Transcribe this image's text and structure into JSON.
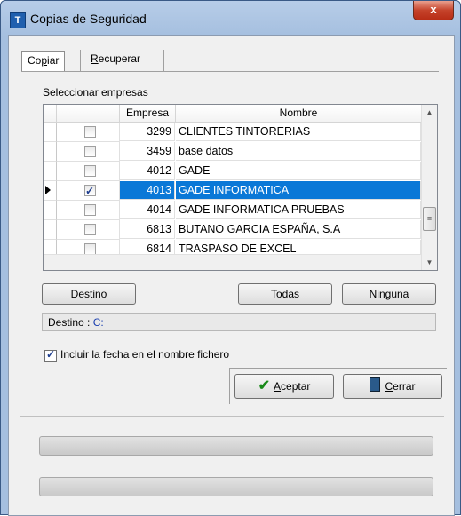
{
  "window": {
    "title": "Copias de Seguridad",
    "close_label": "x",
    "app_icon": "T"
  },
  "tabs": [
    {
      "label_pre": "Co",
      "label_key": "p",
      "label_post": "iar"
    },
    {
      "label_pre": "",
      "label_key": "R",
      "label_post": "ecuperar"
    }
  ],
  "companies": {
    "section_label": "Seleccionar empresas",
    "columns": [
      "Empresa",
      "Nombre"
    ],
    "rows": [
      {
        "empresa": "3299",
        "nombre": "CLIENTES TINTORERIAS",
        "checked": false,
        "selected": false
      },
      {
        "empresa": "3459",
        "nombre": "base datos",
        "checked": false,
        "selected": false
      },
      {
        "empresa": "4012",
        "nombre": "GADE",
        "checked": false,
        "selected": false
      },
      {
        "empresa": "4013",
        "nombre": "GADE INFORMATICA",
        "checked": true,
        "selected": true
      },
      {
        "empresa": "4014",
        "nombre": "GADE INFORMATICA PRUEBAS",
        "checked": false,
        "selected": false
      },
      {
        "empresa": "6813",
        "nombre": "BUTANO GARCIA ESPAÑA, S.A",
        "checked": false,
        "selected": false
      },
      {
        "empresa": "6814",
        "nombre": "TRASPASO DE EXCEL",
        "checked": false,
        "selected": false
      }
    ],
    "scroll_thumb_glyph": "≡"
  },
  "buttons": {
    "destino": "Destino",
    "todas": "Todas",
    "ninguna": "Ninguna"
  },
  "destination": {
    "label": "Destino :",
    "value": "C:"
  },
  "include_date": {
    "label": "Incluir la fecha en el nombre fichero",
    "checked": true
  },
  "actions": {
    "aceptar_key": "A",
    "aceptar_rest": "ceptar",
    "cerrar_key": "C",
    "cerrar_rest": "errar"
  },
  "progress": [
    {
      "value": 0
    },
    {
      "value": 0
    }
  ],
  "colors": {
    "selection": "#0a78d7",
    "destination_value": "#1a3fb0",
    "close_button": "#c5432b"
  },
  "icons": [
    "app-icon",
    "close-icon",
    "row-pointer-icon",
    "checkmark-icon",
    "door-exit-icon",
    "scroll-up-icon",
    "scroll-down-icon"
  ]
}
